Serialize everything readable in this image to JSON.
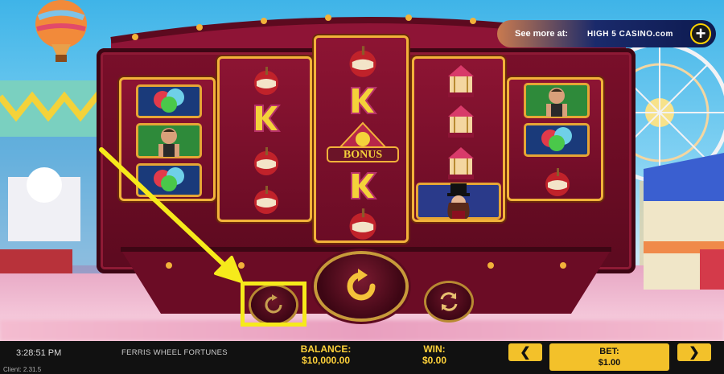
{
  "game": {
    "title": "FERRIS WHEEL FORTUNES",
    "time": "3:28:51 PM",
    "client_version": "Client: 2.31.5"
  },
  "promo": {
    "text": "See more at:",
    "brand": "HIGH 5 CASINO.com",
    "plus": "+"
  },
  "reels": [
    [
      "balloons",
      "strongman",
      "balloons"
    ],
    [
      "candy-apple",
      "k-letter",
      "candy-apple",
      "candy-apple"
    ],
    [
      "candy-apple",
      "k-letter",
      "bonus",
      "k-letter",
      "candy-apple"
    ],
    [
      "carousel",
      "carousel",
      "carousel",
      "ringmaster"
    ],
    [
      "strongman",
      "balloons",
      "candy-apple"
    ]
  ],
  "bonus_label": "BONUS",
  "stats": {
    "balance_label": "BALANCE:",
    "balance_value": "$10,000.00",
    "win_label": "WIN:",
    "win_value": "$0.00",
    "bet_label": "BET:",
    "bet_value": "$1.00"
  },
  "controls": {
    "prev": "❮",
    "next": "❯"
  },
  "colors": {
    "highlight": "#f6ea1b",
    "reel_border": "#f2b23a",
    "wagon": "#7a0f2a",
    "bar_text": "#ffd23a"
  }
}
